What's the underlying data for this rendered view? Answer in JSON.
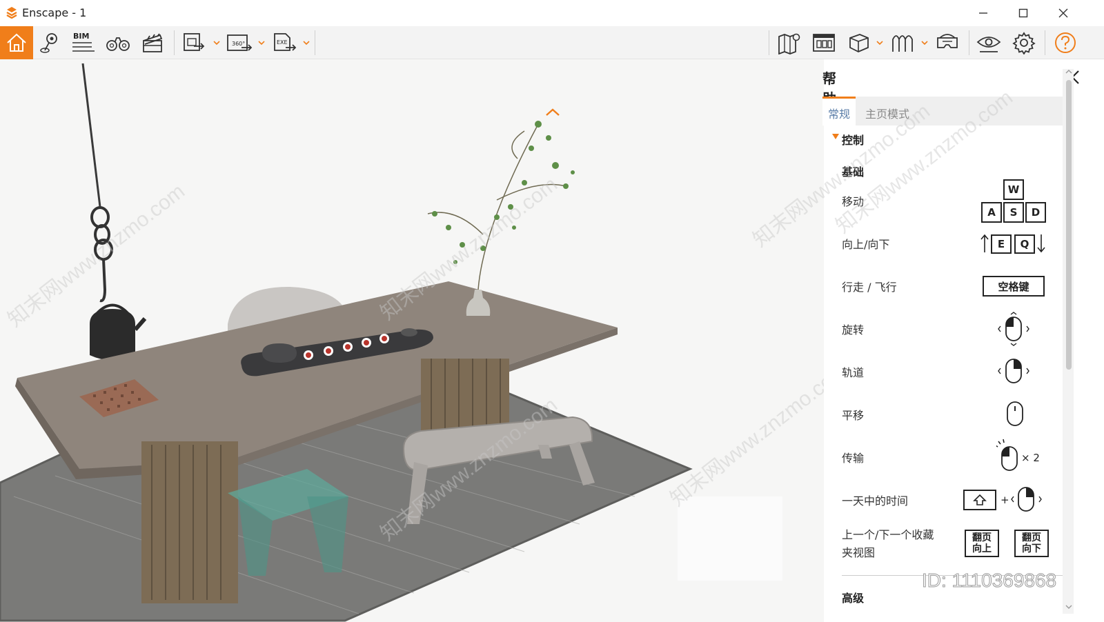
{
  "window": {
    "title": "Enscape - 1"
  },
  "colors": {
    "accent": "#f07e1a",
    "tab_active_text": "#5b7ea8"
  },
  "toolbar": {
    "bim_label": "BIM",
    "panorama_label": "360°",
    "exe_label": "EXE"
  },
  "help_panel": {
    "title": "帮助 [H]",
    "tabs": [
      {
        "label": "常规",
        "active": true
      },
      {
        "label": "主页模式",
        "active": false
      }
    ],
    "section": "控制",
    "subsection": "基础",
    "rows": {
      "move": {
        "label": "移动",
        "keys": [
          "W",
          "A",
          "S",
          "D"
        ]
      },
      "updown": {
        "label": "向上/向下",
        "keys": [
          "E",
          "Q"
        ]
      },
      "walkfly": {
        "label": "行走 / 飞行",
        "key": "空格键"
      },
      "rotate": {
        "label": "旋转"
      },
      "orbit": {
        "label": "轨道"
      },
      "pan": {
        "label": "平移"
      },
      "teleport": {
        "label": "传输",
        "multiplier": "× 2"
      },
      "time_of_day": {
        "label": "一天中的时间",
        "plus": "+"
      },
      "bookmark": {
        "label_line1": "上一个/下一个收藏",
        "label_line2": "夹视图",
        "key_prev_line1": "翻页",
        "key_prev_line2": "向上",
        "key_next_line1": "翻页",
        "key_next_line2": "向下"
      }
    },
    "advanced": "高级"
  },
  "watermark": {
    "id_text": "ID: 1110369868",
    "site": "知末网www.znzmo.com"
  }
}
